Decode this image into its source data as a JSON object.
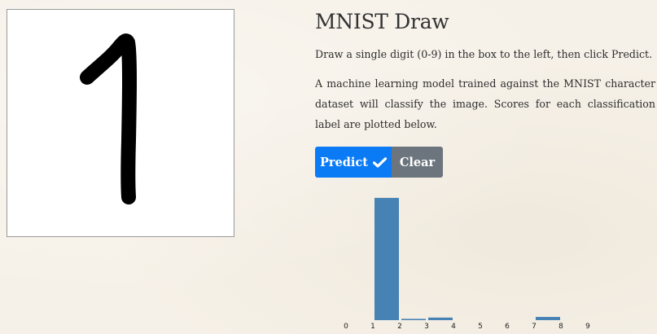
{
  "header": {
    "title": "MNIST Draw"
  },
  "instructions": "Draw a single digit (0-9) in the box to the left, then click Predict.",
  "description": "A machine learning model trained against the MNIST character dataset will classify the image. Scores for each classification label are plotted below.",
  "buttons": {
    "predict_label": "Predict",
    "predict_icon": "checkmark-icon",
    "clear_label": "Clear",
    "predict_color": "#0a7bf5",
    "clear_color": "#6c757d"
  },
  "drawing": {
    "content": "handwritten digit 1",
    "stroke_color": "#000000"
  },
  "chart_data": {
    "type": "bar",
    "categories": [
      "0",
      "1",
      "2",
      "3",
      "4",
      "5",
      "6",
      "7",
      "8",
      "9"
    ],
    "values": [
      0.0,
      0.95,
      0.01,
      0.02,
      0.0,
      0.0,
      0.0,
      0.025,
      0.0,
      0.0
    ],
    "ylim": [
      0,
      1
    ],
    "bar_color": "#4682b4",
    "grid": false,
    "xlabel": "",
    "ylabel": "",
    "title": ""
  }
}
